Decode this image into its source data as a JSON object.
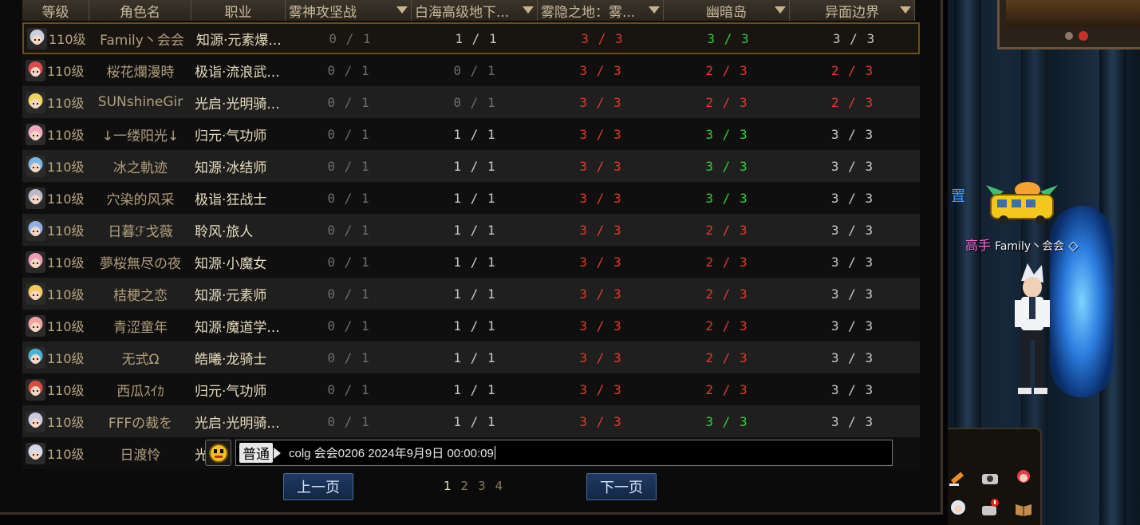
{
  "headers": {
    "level": "等级",
    "name": "角色名",
    "job": "职业",
    "col1": "雾神攻坚战",
    "col2": "白海高级地下...",
    "col3": "雾隐之地：雾...",
    "col4": "幽暗岛",
    "col5": "异面边界"
  },
  "rows": [
    {
      "level": "110级",
      "name": "Family丶会会",
      "job": "知源·元素爆...",
      "p1": "0 / 1",
      "p2": "1 / 1",
      "p3": "3 / 3",
      "p4": "3 / 3",
      "p5": "3 / 3"
    },
    {
      "level": "110级",
      "name": "桜花爛漫時",
      "job": "极诣·流浪武...",
      "p1": "0 / 1",
      "p2": "0 / 1",
      "p3": "3 / 3",
      "p4": "2 / 3",
      "p5": "2 / 3"
    },
    {
      "level": "110级",
      "name": "SUNshineGir",
      "job": "光启·光明骑...",
      "p1": "0 / 1",
      "p2": "0 / 1",
      "p3": "3 / 3",
      "p4": "2 / 3",
      "p5": "2 / 3"
    },
    {
      "level": "110级",
      "name": "↓一缕阳光↓",
      "job": "归元·气功师",
      "p1": "0 / 1",
      "p2": "1 / 1",
      "p3": "3 / 3",
      "p4": "3 / 3",
      "p5": "3 / 3"
    },
    {
      "level": "110级",
      "name": "冰之軌迹",
      "job": "知源·冰结师",
      "p1": "0 / 1",
      "p2": "1 / 1",
      "p3": "3 / 3",
      "p4": "3 / 3",
      "p5": "3 / 3"
    },
    {
      "level": "110级",
      "name": "穴染的风采",
      "job": "极诣·狂战士",
      "p1": "0 / 1",
      "p2": "1 / 1",
      "p3": "3 / 3",
      "p4": "3 / 3",
      "p5": "3 / 3"
    },
    {
      "level": "110级",
      "name": "日暮ℱ戈薇",
      "job": "聆风·旅人",
      "p1": "0 / 1",
      "p2": "1 / 1",
      "p3": "3 / 3",
      "p4": "2 / 3",
      "p5": "3 / 3"
    },
    {
      "level": "110级",
      "name": "夢桜無尽の夜",
      "job": "知源·小魔女",
      "p1": "0 / 1",
      "p2": "1 / 1",
      "p3": "3 / 3",
      "p4": "2 / 3",
      "p5": "3 / 3"
    },
    {
      "level": "110级",
      "name": "桔梗之恋",
      "job": "知源·元素师",
      "p1": "0 / 1",
      "p2": "1 / 1",
      "p3": "3 / 3",
      "p4": "2 / 3",
      "p5": "3 / 3"
    },
    {
      "level": "110级",
      "name": "青涩童年",
      "job": "知源·魔道学...",
      "p1": "0 / 1",
      "p2": "1 / 1",
      "p3": "3 / 3",
      "p4": "2 / 3",
      "p5": "3 / 3"
    },
    {
      "level": "110级",
      "name": "无式Ω",
      "job": "皓曦·龙骑士",
      "p1": "0 / 1",
      "p2": "1 / 1",
      "p3": "3 / 3",
      "p4": "2 / 3",
      "p5": "3 / 3"
    },
    {
      "level": "110级",
      "name": "西瓜ｽｲｶ",
      "job": "归元·气功师",
      "p1": "0 / 1",
      "p2": "1 / 1",
      "p3": "3 / 3",
      "p4": "2 / 3",
      "p5": "3 / 3"
    },
    {
      "level": "110级",
      "name": "FFFの裁を",
      "job": "光启·光明骑...",
      "p1": "0 / 1",
      "p2": "1 / 1",
      "p3": "3 / 3",
      "p4": "3 / 3",
      "p5": "3 / 3"
    },
    {
      "level": "110级",
      "name": "日渡怜",
      "job": "光",
      "p1": "",
      "p2": "",
      "p3": "",
      "p4": "",
      "p5": ""
    }
  ],
  "progress_colors": {
    "p1": [
      "gray",
      "gray",
      "gray",
      "gray",
      "gray",
      "gray",
      "gray",
      "gray",
      "gray",
      "gray",
      "gray",
      "gray",
      "gray",
      "gray"
    ],
    "p2": [
      "white",
      "gray",
      "gray",
      "white",
      "white",
      "white",
      "white",
      "white",
      "white",
      "white",
      "white",
      "white",
      "white",
      "white"
    ],
    "p3": [
      "red",
      "red",
      "red",
      "red",
      "red",
      "red",
      "red",
      "red",
      "red",
      "red",
      "red",
      "red",
      "red",
      "red"
    ],
    "p4": [
      "green",
      "red",
      "red",
      "green",
      "green",
      "green",
      "red",
      "red",
      "red",
      "red",
      "red",
      "red",
      "green",
      "red"
    ],
    "p5": [
      "white",
      "red",
      "red",
      "white",
      "white",
      "white",
      "white",
      "white",
      "white",
      "white",
      "white",
      "white",
      "white",
      "white"
    ]
  },
  "chat": {
    "channel": "普通",
    "text": "colg 会会0206 2024年9月9日 00:00:09"
  },
  "pagination": {
    "prev": "上一页",
    "next": "下一页",
    "pages": [
      "1",
      "2",
      "3",
      "4"
    ],
    "current": "1"
  },
  "game": {
    "player_title": "高手",
    "player_name": "Family丶会会",
    "partial_text": "置"
  },
  "colors": {
    "accent_border": "#6b4e14",
    "red": "#e23a2a",
    "green": "#2fcf3a",
    "button_blue": "#203a66"
  }
}
